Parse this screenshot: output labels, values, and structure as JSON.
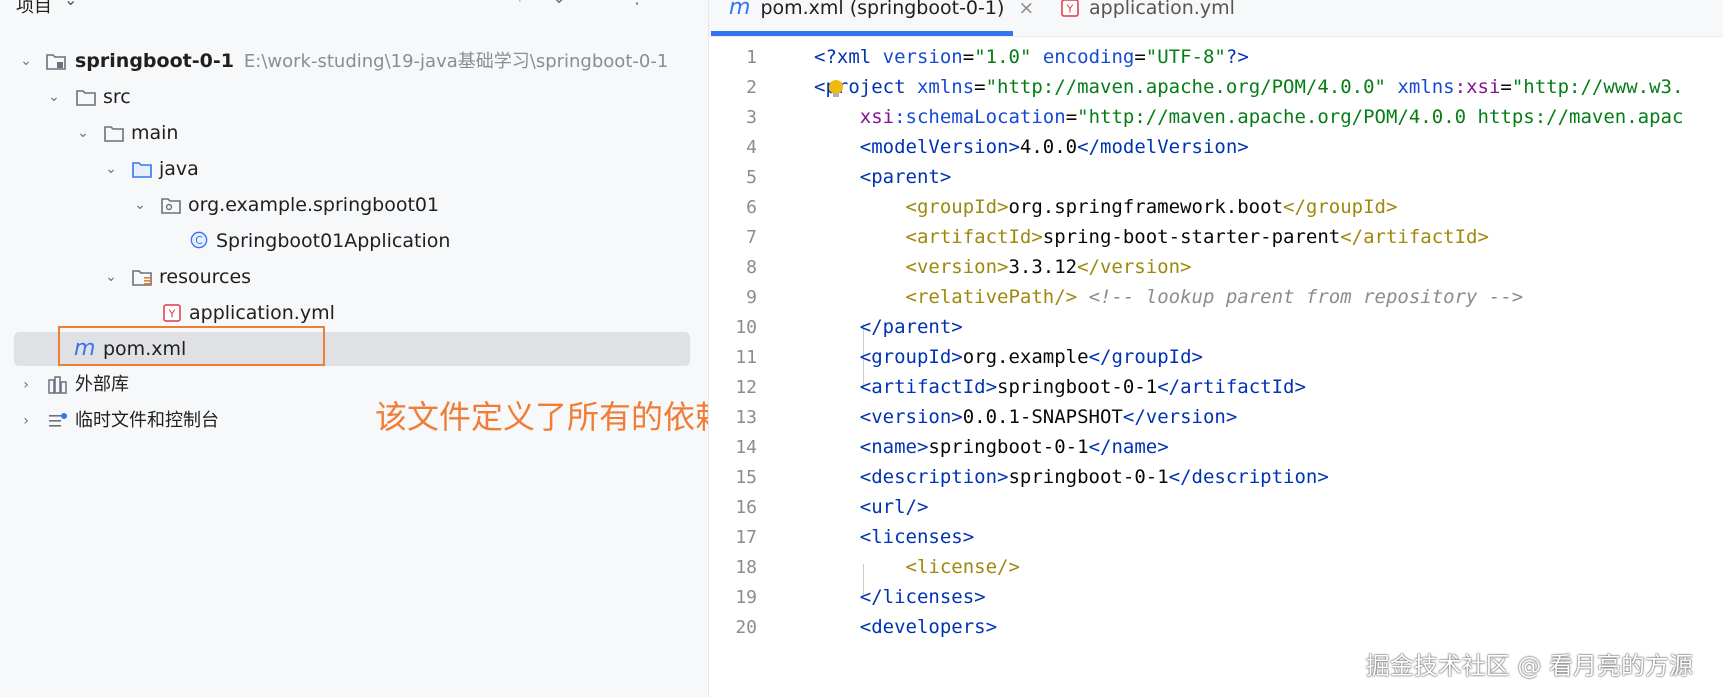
{
  "project_panel": {
    "title": "项目",
    "header_icons": [
      "crosshair-icon",
      "expand-icon",
      "collapse-icon",
      "more-icon",
      "minimize-icon"
    ],
    "root": {
      "label": "springboot-0-1",
      "path": "E:\\work-studing\\19-java基础学习\\springboot-0-1"
    },
    "src": "src",
    "main": "main",
    "java": "java",
    "package": "org.example.springboot01",
    "app_class": "Springboot01Application",
    "resources": "resources",
    "app_yml": "application.yml",
    "pom": "pom.xml",
    "external_libs": "外部库",
    "scratches": "临时文件和控制台"
  },
  "annotation": "该文件定义了所有的依赖",
  "editor": {
    "tabs": [
      {
        "label": "pom.xml (springboot-0-1)",
        "icon": "m",
        "active": true
      },
      {
        "label": "application.yml",
        "icon": "Y",
        "active": false
      }
    ],
    "tab_close": "×",
    "lines": [
      {
        "n": "1",
        "t": [
          [
            "c-pi",
            "<?"
          ],
          [
            "c-tag",
            "xml "
          ],
          [
            "c-attr",
            "version"
          ],
          [
            "c-text",
            "="
          ],
          [
            "c-str",
            "\"1.0\" "
          ],
          [
            "c-attr",
            "encoding"
          ],
          [
            "c-text",
            "="
          ],
          [
            "c-str",
            "\"UTF-8\""
          ],
          [
            "c-pi",
            "?>"
          ]
        ]
      },
      {
        "n": "2",
        "t": [
          [
            "c-tag",
            "<project "
          ],
          [
            "c-attr",
            "xmlns"
          ],
          [
            "c-text",
            "="
          ],
          [
            "c-str",
            "\"http://maven.apache.org/POM/4.0.0\" "
          ],
          [
            "c-attr",
            "xmlns"
          ],
          [
            "c-ns",
            ":xsi"
          ],
          [
            "c-text",
            "="
          ],
          [
            "c-str",
            "\"http://www.w3."
          ]
        ]
      },
      {
        "n": "3",
        "t": [
          [
            "c-text",
            "    "
          ],
          [
            "c-ns",
            "xsi"
          ],
          [
            "c-attr",
            ":schemaLocation"
          ],
          [
            "c-text",
            "="
          ],
          [
            "c-str",
            "\"http://maven.apache.org/POM/4.0.0 https://maven.apac"
          ]
        ]
      },
      {
        "n": "4",
        "t": [
          [
            "c-text",
            "    "
          ],
          [
            "c-tag",
            "<modelVersion>"
          ],
          [
            "c-text",
            "4.0.0"
          ],
          [
            "c-tag",
            "</modelVersion>"
          ]
        ]
      },
      {
        "n": "5",
        "t": [
          [
            "c-text",
            "    "
          ],
          [
            "c-tag",
            "<parent>"
          ]
        ]
      },
      {
        "n": "6",
        "t": [
          [
            "c-text",
            "        "
          ],
          [
            "c-tag2",
            "<groupId>"
          ],
          [
            "c-text",
            "org.springframework.boot"
          ],
          [
            "c-tag2",
            "</groupId>"
          ]
        ]
      },
      {
        "n": "7",
        "t": [
          [
            "c-text",
            "        "
          ],
          [
            "c-tag2",
            "<artifactId>"
          ],
          [
            "c-text",
            "spring-boot-starter-parent"
          ],
          [
            "c-tag2",
            "</artifactId>"
          ]
        ]
      },
      {
        "n": "8",
        "t": [
          [
            "c-text",
            "        "
          ],
          [
            "c-tag2",
            "<version>"
          ],
          [
            "c-text",
            "3.3.12"
          ],
          [
            "c-tag2",
            "</version>"
          ]
        ]
      },
      {
        "n": "9",
        "t": [
          [
            "c-text",
            "        "
          ],
          [
            "c-tag2",
            "<relativePath/>"
          ],
          [
            "c-text",
            " "
          ],
          [
            "c-cmt",
            "<!-- lookup parent from repository -->"
          ]
        ]
      },
      {
        "n": "10",
        "t": [
          [
            "c-text",
            "    "
          ],
          [
            "c-tag",
            "</parent>"
          ]
        ]
      },
      {
        "n": "11",
        "t": [
          [
            "c-text",
            "    "
          ],
          [
            "c-tag",
            "<groupId>"
          ],
          [
            "c-text",
            "org.example"
          ],
          [
            "c-tag",
            "</groupId>"
          ]
        ]
      },
      {
        "n": "12",
        "t": [
          [
            "c-text",
            "    "
          ],
          [
            "c-tag",
            "<artifactId>"
          ],
          [
            "c-text",
            "springboot-0-1"
          ],
          [
            "c-tag",
            "</artifactId>"
          ]
        ]
      },
      {
        "n": "13",
        "t": [
          [
            "c-text",
            "    "
          ],
          [
            "c-tag",
            "<version>"
          ],
          [
            "c-text",
            "0.0.1-SNAPSHOT"
          ],
          [
            "c-tag",
            "</version>"
          ]
        ]
      },
      {
        "n": "14",
        "t": [
          [
            "c-text",
            "    "
          ],
          [
            "c-tag",
            "<name>"
          ],
          [
            "c-text",
            "springboot-0-1"
          ],
          [
            "c-tag",
            "</name>"
          ]
        ]
      },
      {
        "n": "15",
        "t": [
          [
            "c-text",
            "    "
          ],
          [
            "c-tag",
            "<description>"
          ],
          [
            "c-text",
            "springboot-0-1"
          ],
          [
            "c-tag",
            "</description>"
          ]
        ]
      },
      {
        "n": "16",
        "t": [
          [
            "c-text",
            "    "
          ],
          [
            "c-tag",
            "<url/>"
          ]
        ]
      },
      {
        "n": "17",
        "t": [
          [
            "c-text",
            "    "
          ],
          [
            "c-tag",
            "<licenses>"
          ]
        ]
      },
      {
        "n": "18",
        "t": [
          [
            "c-text",
            "        "
          ],
          [
            "c-tag2",
            "<license/>"
          ]
        ]
      },
      {
        "n": "19",
        "t": [
          [
            "c-text",
            "    "
          ],
          [
            "c-tag",
            "</licenses>"
          ]
        ]
      },
      {
        "n": "20",
        "t": [
          [
            "c-text",
            "    "
          ],
          [
            "c-tag",
            "<developers>"
          ]
        ]
      }
    ]
  },
  "watermark": "掘金技术社区 @ 看月亮的方源"
}
